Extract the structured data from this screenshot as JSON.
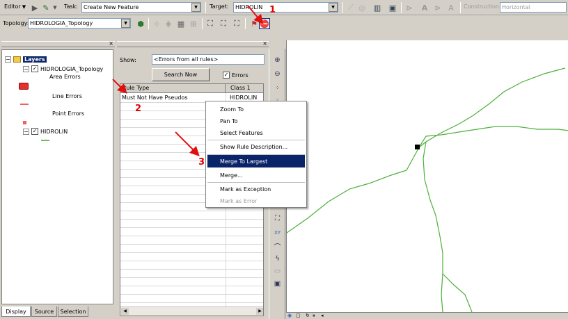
{
  "toolbar1": {
    "editor_label": "Editor",
    "task_label": "Task:",
    "task_value": "Create New Feature",
    "target_label": "Target:",
    "target_value": "HIDROLIN",
    "construction_label": "Construction:",
    "construction_value": "Horizontal"
  },
  "toolbar2": {
    "topology_label": "Topology:",
    "topology_value": "HIDROLOGIA_Topology"
  },
  "toc": {
    "root_label": "Layers",
    "topology_layer": "HIDROLOGIA_Topology",
    "area_errors": "Area Errors",
    "line_errors": "Line Errors",
    "point_errors": "Point Errors",
    "hidrolin": "HIDROLIN",
    "tabs": [
      "Display",
      "Source",
      "Selection"
    ]
  },
  "inspector": {
    "show_label": "Show:",
    "show_value": "<Errors from all rules>",
    "search_button": "Search Now",
    "errors_checkbox": "Errors",
    "col_rule_type": "Rule Type",
    "col_class1": "Class 1",
    "rows": [
      {
        "rule": "Must Not Have Pseudos",
        "class1": "HIDROLIN"
      }
    ]
  },
  "context_menu": {
    "items": [
      "Zoom To",
      "Pan To",
      "Select Features",
      "Show Rule Description...",
      "Merge To Largest",
      "Merge...",
      "Mark as Exception",
      "Mark as Error"
    ],
    "highlighted_index": 4
  },
  "annotations": {
    "n1": "1",
    "n2": "2",
    "n3": "3"
  },
  "colors": {
    "annotation_red": "#e01010",
    "menu_highlight": "#0a246a",
    "river_line": "#4caf3a"
  }
}
